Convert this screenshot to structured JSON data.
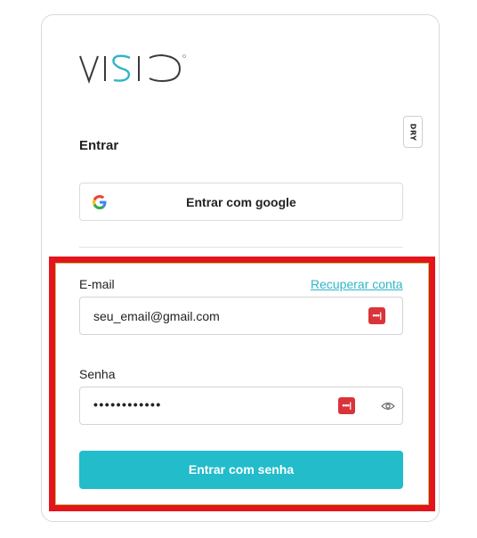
{
  "brand": {
    "logo_text": "VISIO",
    "accent_color": "#2FB6C7"
  },
  "badge": {
    "text": "DRY"
  },
  "login": {
    "title": "Entrar",
    "google_button_label": "Entrar com google",
    "email_label": "E-mail",
    "recover_link": "Recuperar conta",
    "email_value": "seu_email@gmail.com",
    "password_label": "Senha",
    "password_value": "••••••••••••",
    "submit_label": "Entrar com senha"
  },
  "icons": {
    "google": "google-icon",
    "password_manager": "password-manager-icon",
    "show_password": "eye-icon"
  },
  "colors": {
    "primary_button": "#22BCCB",
    "highlight_border": "#E3141B",
    "password_manager": "#D8343A"
  }
}
